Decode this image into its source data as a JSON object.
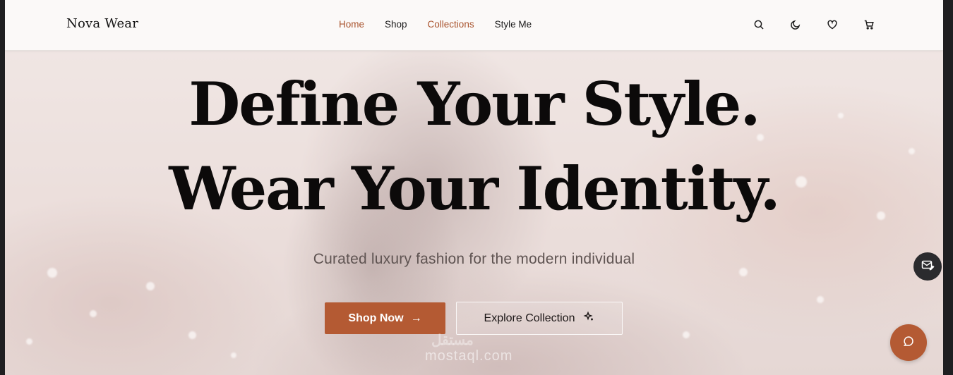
{
  "header": {
    "logo": "Nova Wear",
    "nav": [
      {
        "label": "Home",
        "active": true
      },
      {
        "label": "Shop",
        "active": false
      },
      {
        "label": "Collections",
        "active": true
      },
      {
        "label": "Style Me",
        "active": false
      }
    ],
    "icons": [
      "search-icon",
      "moon-icon",
      "heart-icon",
      "cart-icon"
    ]
  },
  "hero": {
    "headline_line1": "Define Your Style.",
    "headline_line2": "Wear Your Identity.",
    "subtitle": "Curated luxury fashion for the modern individual",
    "primary_button": "Shop Now",
    "primary_button_icon": "arrow-right-icon",
    "secondary_button": "Explore Collection",
    "secondary_button_icon": "sparkle-icon"
  },
  "watermark": {
    "logo_text": "مستقل",
    "text": "mostaql.com"
  },
  "floating": {
    "mail_icon": "mail-edit-icon",
    "chat_icon": "chat-icon"
  },
  "colors": {
    "accent": "#b45a33",
    "nav_accent": "#a9542e",
    "text_dark": "#0c0a0a"
  }
}
